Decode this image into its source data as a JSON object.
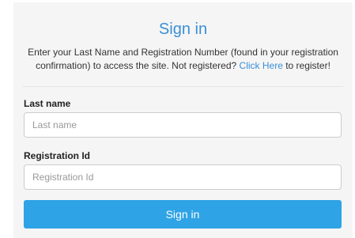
{
  "signin": {
    "title": "Sign in",
    "intro_text": "Enter your Last Name and Registration Number (found in your registration confirmation) to access the site. Not registered? ",
    "register_link": "Click Here",
    "intro_suffix": " to register!",
    "last_name": {
      "label": "Last name",
      "placeholder": "Last name",
      "value": ""
    },
    "registration_id": {
      "label": "Registration Id",
      "placeholder": "Registration Id",
      "value": ""
    },
    "submit_label": "Sign in"
  },
  "colors": {
    "accent": "#3a8fd6",
    "button": "#2ea3e5",
    "panel_bg": "#f5f5f5"
  }
}
